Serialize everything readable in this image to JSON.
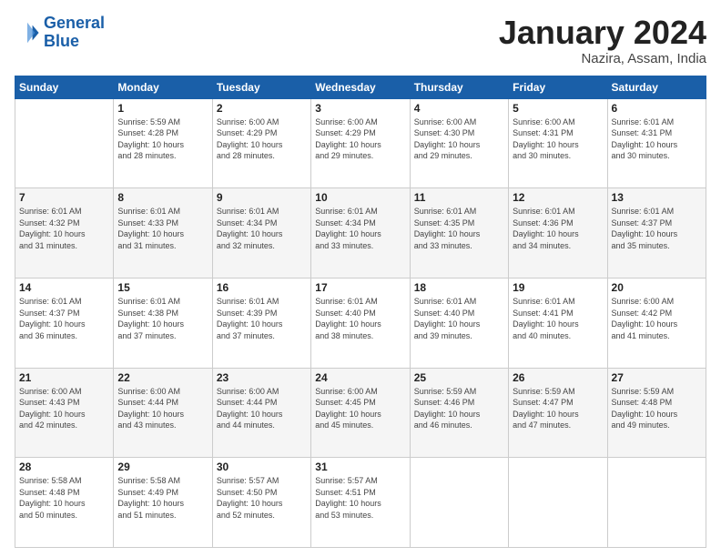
{
  "header": {
    "logo_line1": "General",
    "logo_line2": "Blue",
    "month": "January 2024",
    "location": "Nazira, Assam, India"
  },
  "weekdays": [
    "Sunday",
    "Monday",
    "Tuesday",
    "Wednesday",
    "Thursday",
    "Friday",
    "Saturday"
  ],
  "weeks": [
    [
      {
        "day": "",
        "info": ""
      },
      {
        "day": "1",
        "info": "Sunrise: 5:59 AM\nSunset: 4:28 PM\nDaylight: 10 hours\nand 28 minutes."
      },
      {
        "day": "2",
        "info": "Sunrise: 6:00 AM\nSunset: 4:29 PM\nDaylight: 10 hours\nand 28 minutes."
      },
      {
        "day": "3",
        "info": "Sunrise: 6:00 AM\nSunset: 4:29 PM\nDaylight: 10 hours\nand 29 minutes."
      },
      {
        "day": "4",
        "info": "Sunrise: 6:00 AM\nSunset: 4:30 PM\nDaylight: 10 hours\nand 29 minutes."
      },
      {
        "day": "5",
        "info": "Sunrise: 6:00 AM\nSunset: 4:31 PM\nDaylight: 10 hours\nand 30 minutes."
      },
      {
        "day": "6",
        "info": "Sunrise: 6:01 AM\nSunset: 4:31 PM\nDaylight: 10 hours\nand 30 minutes."
      }
    ],
    [
      {
        "day": "7",
        "info": "Sunrise: 6:01 AM\nSunset: 4:32 PM\nDaylight: 10 hours\nand 31 minutes."
      },
      {
        "day": "8",
        "info": "Sunrise: 6:01 AM\nSunset: 4:33 PM\nDaylight: 10 hours\nand 31 minutes."
      },
      {
        "day": "9",
        "info": "Sunrise: 6:01 AM\nSunset: 4:34 PM\nDaylight: 10 hours\nand 32 minutes."
      },
      {
        "day": "10",
        "info": "Sunrise: 6:01 AM\nSunset: 4:34 PM\nDaylight: 10 hours\nand 33 minutes."
      },
      {
        "day": "11",
        "info": "Sunrise: 6:01 AM\nSunset: 4:35 PM\nDaylight: 10 hours\nand 33 minutes."
      },
      {
        "day": "12",
        "info": "Sunrise: 6:01 AM\nSunset: 4:36 PM\nDaylight: 10 hours\nand 34 minutes."
      },
      {
        "day": "13",
        "info": "Sunrise: 6:01 AM\nSunset: 4:37 PM\nDaylight: 10 hours\nand 35 minutes."
      }
    ],
    [
      {
        "day": "14",
        "info": "Sunrise: 6:01 AM\nSunset: 4:37 PM\nDaylight: 10 hours\nand 36 minutes."
      },
      {
        "day": "15",
        "info": "Sunrise: 6:01 AM\nSunset: 4:38 PM\nDaylight: 10 hours\nand 37 minutes."
      },
      {
        "day": "16",
        "info": "Sunrise: 6:01 AM\nSunset: 4:39 PM\nDaylight: 10 hours\nand 37 minutes."
      },
      {
        "day": "17",
        "info": "Sunrise: 6:01 AM\nSunset: 4:40 PM\nDaylight: 10 hours\nand 38 minutes."
      },
      {
        "day": "18",
        "info": "Sunrise: 6:01 AM\nSunset: 4:40 PM\nDaylight: 10 hours\nand 39 minutes."
      },
      {
        "day": "19",
        "info": "Sunrise: 6:01 AM\nSunset: 4:41 PM\nDaylight: 10 hours\nand 40 minutes."
      },
      {
        "day": "20",
        "info": "Sunrise: 6:00 AM\nSunset: 4:42 PM\nDaylight: 10 hours\nand 41 minutes."
      }
    ],
    [
      {
        "day": "21",
        "info": "Sunrise: 6:00 AM\nSunset: 4:43 PM\nDaylight: 10 hours\nand 42 minutes."
      },
      {
        "day": "22",
        "info": "Sunrise: 6:00 AM\nSunset: 4:44 PM\nDaylight: 10 hours\nand 43 minutes."
      },
      {
        "day": "23",
        "info": "Sunrise: 6:00 AM\nSunset: 4:44 PM\nDaylight: 10 hours\nand 44 minutes."
      },
      {
        "day": "24",
        "info": "Sunrise: 6:00 AM\nSunset: 4:45 PM\nDaylight: 10 hours\nand 45 minutes."
      },
      {
        "day": "25",
        "info": "Sunrise: 5:59 AM\nSunset: 4:46 PM\nDaylight: 10 hours\nand 46 minutes."
      },
      {
        "day": "26",
        "info": "Sunrise: 5:59 AM\nSunset: 4:47 PM\nDaylight: 10 hours\nand 47 minutes."
      },
      {
        "day": "27",
        "info": "Sunrise: 5:59 AM\nSunset: 4:48 PM\nDaylight: 10 hours\nand 49 minutes."
      }
    ],
    [
      {
        "day": "28",
        "info": "Sunrise: 5:58 AM\nSunset: 4:48 PM\nDaylight: 10 hours\nand 50 minutes."
      },
      {
        "day": "29",
        "info": "Sunrise: 5:58 AM\nSunset: 4:49 PM\nDaylight: 10 hours\nand 51 minutes."
      },
      {
        "day": "30",
        "info": "Sunrise: 5:57 AM\nSunset: 4:50 PM\nDaylight: 10 hours\nand 52 minutes."
      },
      {
        "day": "31",
        "info": "Sunrise: 5:57 AM\nSunset: 4:51 PM\nDaylight: 10 hours\nand 53 minutes."
      },
      {
        "day": "",
        "info": ""
      },
      {
        "day": "",
        "info": ""
      },
      {
        "day": "",
        "info": ""
      }
    ]
  ]
}
